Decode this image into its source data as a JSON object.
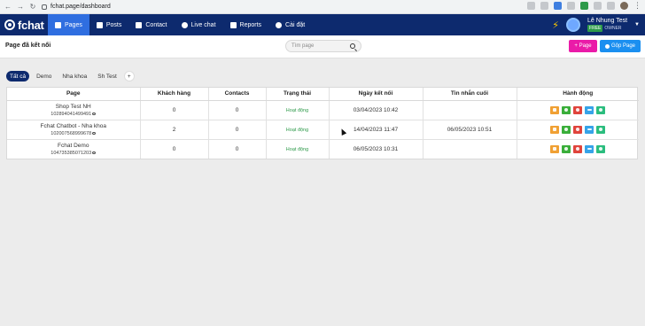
{
  "browser": {
    "url": "fchat.page/dashboard"
  },
  "app": {
    "logo_text": "fchat",
    "menu": [
      {
        "label": "Pages",
        "icon": "pages-icon",
        "active": true
      },
      {
        "label": "Posts",
        "icon": "posts-icon",
        "active": false
      },
      {
        "label": "Contact",
        "icon": "contact-icon",
        "active": false
      },
      {
        "label": "Live chat",
        "icon": "live-chat-icon",
        "active": false
      },
      {
        "label": "Reports",
        "icon": "reports-icon",
        "active": false
      },
      {
        "label": "Cài đặt",
        "icon": "settings-icon",
        "active": false
      }
    ],
    "user": {
      "name": "Lê Nhung Test",
      "badge": "FREE",
      "role": "OWNER"
    }
  },
  "toolbar": {
    "title": "Page đã kết nối",
    "search_placeholder": "Tìm page",
    "add_page_label": "+ Page",
    "merge_page_label": "Gộp Page"
  },
  "tabs": [
    {
      "label": "Tất cả",
      "active": true
    },
    {
      "label": "Demo",
      "active": false
    },
    {
      "label": "Nha khoa",
      "active": false
    },
    {
      "label": "Sh Test",
      "active": false
    },
    {
      "label": "+",
      "active": false
    }
  ],
  "table": {
    "headers": [
      "Page",
      "Khách hàng",
      "Contacts",
      "Trạng thái",
      "Ngày kết nối",
      "Tin nhắn cuối",
      "Hành động"
    ],
    "rows": [
      {
        "name": "Shop Test NH",
        "id": "102894041499491",
        "customers": "0",
        "contacts": "0",
        "status": "Hoạt động",
        "connected": "03/04/2023 10:42",
        "last_message": ""
      },
      {
        "name": "Fchat Chatbot - Nha khoa",
        "id": "102007568999678",
        "customers": "2",
        "contacts": "0",
        "status": "Hoạt động",
        "connected": "14/04/2023 11:47",
        "last_message": "06/05/2023 10:51"
      },
      {
        "name": "Fchat Demo",
        "id": "104735385071203",
        "customers": "0",
        "contacts": "0",
        "status": "Hoạt động",
        "connected": "06/05/2023 10:31",
        "last_message": ""
      }
    ]
  },
  "colors": {
    "header_bg": "#0d2a6e",
    "active_menu": "#2f6ee0",
    "add_page_btn": "#ea1ba8",
    "merge_btn": "#1b8ff0",
    "status_active": "#2e9a4a"
  }
}
